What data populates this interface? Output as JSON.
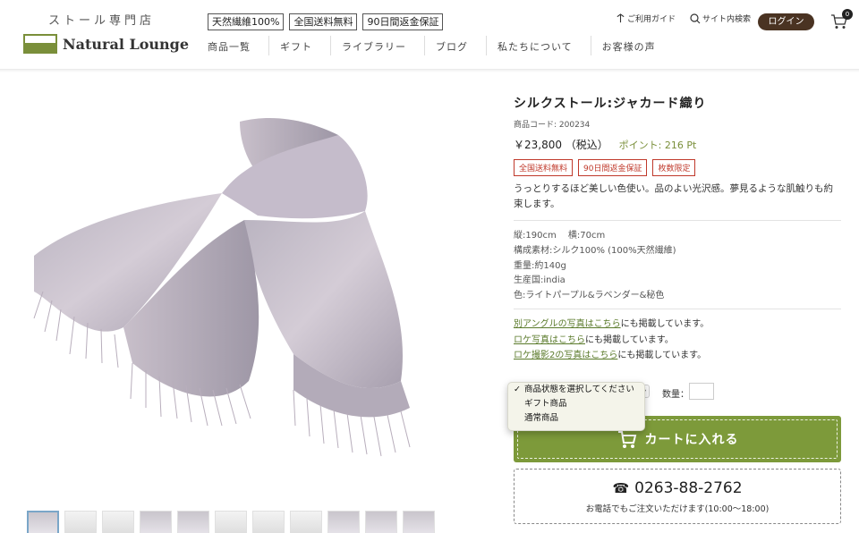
{
  "header": {
    "tagline": "ストール専門店",
    "logo_text": "Natural Lounge",
    "badges": [
      "天然繊維100%",
      "全国送料無料",
      "90日間返金保証"
    ],
    "nav": [
      "商品一覧",
      "ギフト",
      "ライブラリー",
      "ブログ",
      "私たちについて",
      "お客様の声"
    ],
    "guide_label": "ご利用ガイド",
    "search_label": "サイト内検索",
    "login_label": "ログイン",
    "cart_count": "0"
  },
  "product": {
    "title": "シルクストール:ジャカード織り",
    "code": "商品コード: 200234",
    "price": "￥23,800 （税込）",
    "points": "ポイント: 216 Pt",
    "tags": [
      "全国送料無料",
      "90日間返金保証",
      "枚数限定"
    ],
    "description": "うっとりするほど美しい色使い。品のよい光沢感。夢見るような肌触りも約束します。",
    "specs": [
      "縦:190cm　 横:70cm",
      "構成素材:シルク100% (100%天然繊維)",
      "重量:約140g",
      "生産国:india",
      "色:ライトパープル&ラベンダー&秘色"
    ],
    "links": [
      {
        "link": "別アングルの写真はこちら",
        "rest": "にも掲載しています。"
      },
      {
        "link": "ロケ写真はこちら",
        "rest": "にも掲載しています。"
      },
      {
        "link": "ロケ撮影2の写真はこちら",
        "rest": "にも掲載しています。"
      }
    ],
    "select_options": [
      "商品状態を選択してください",
      "ギフト商品",
      "通常商品"
    ],
    "qty_label": "数量：",
    "cart_button": "カートに入れる",
    "phone": "0263-88-2762",
    "phone_note": "お電話でもご注文いただけます(10:00〜18:00)"
  },
  "colors": {
    "brand_green": "#7d9a3a",
    "login_brown": "#4a3322",
    "tag_red": "#c0392b"
  }
}
